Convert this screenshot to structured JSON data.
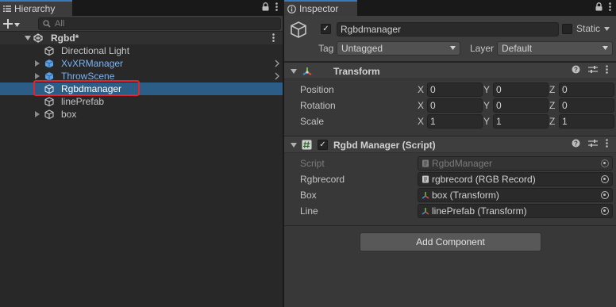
{
  "hierarchy": {
    "tab_label": "Hierarchy",
    "search_placeholder": "All",
    "scene_name": "Rgbd*",
    "items": [
      {
        "label": "Directional Light"
      },
      {
        "label": "XvXRManager"
      },
      {
        "label": "ThrowScene"
      },
      {
        "label": "Rgbdmanager"
      },
      {
        "label": "linePrefab"
      },
      {
        "label": "box"
      }
    ]
  },
  "inspector": {
    "tab_label": "Inspector",
    "object_name": "Rgbdmanager",
    "static_label": "Static",
    "tag_label": "Tag",
    "tag_value": "Untagged",
    "layer_label": "Layer",
    "layer_value": "Default",
    "transform": {
      "title": "Transform",
      "position_label": "Position",
      "rotation_label": "Rotation",
      "scale_label": "Scale",
      "axis_x": "X",
      "axis_y": "Y",
      "axis_z": "Z",
      "position": [
        "0",
        "0",
        "0"
      ],
      "rotation": [
        "0",
        "0",
        "0"
      ],
      "scale": [
        "1",
        "1",
        "1"
      ]
    },
    "script_component": {
      "title": "Rgbd Manager (Script)",
      "script_label": "Script",
      "script_value": "RgbdManager",
      "rgbrecord_label": "Rgbrecord",
      "rgbrecord_value": "rgbrecord (RGB Record)",
      "box_label": "Box",
      "box_value": "box (Transform)",
      "line_label": "Line",
      "line_value": "linePrefab (Transform)"
    },
    "add_component_label": "Add Component"
  },
  "colors": {
    "selection": "#2c5d87",
    "prefab_text": "#7cb3f1",
    "highlight_box": "#e3252b",
    "tab_accent": "#3a79bb"
  },
  "icons": {
    "hierarchy_tab": "list-icon",
    "inspector_tab": "info-icon",
    "gameobject": "cube-outline-icon",
    "prefab": "cube-filled-icon",
    "transform": "transform-axes-icon",
    "script": "script-hash-icon"
  }
}
